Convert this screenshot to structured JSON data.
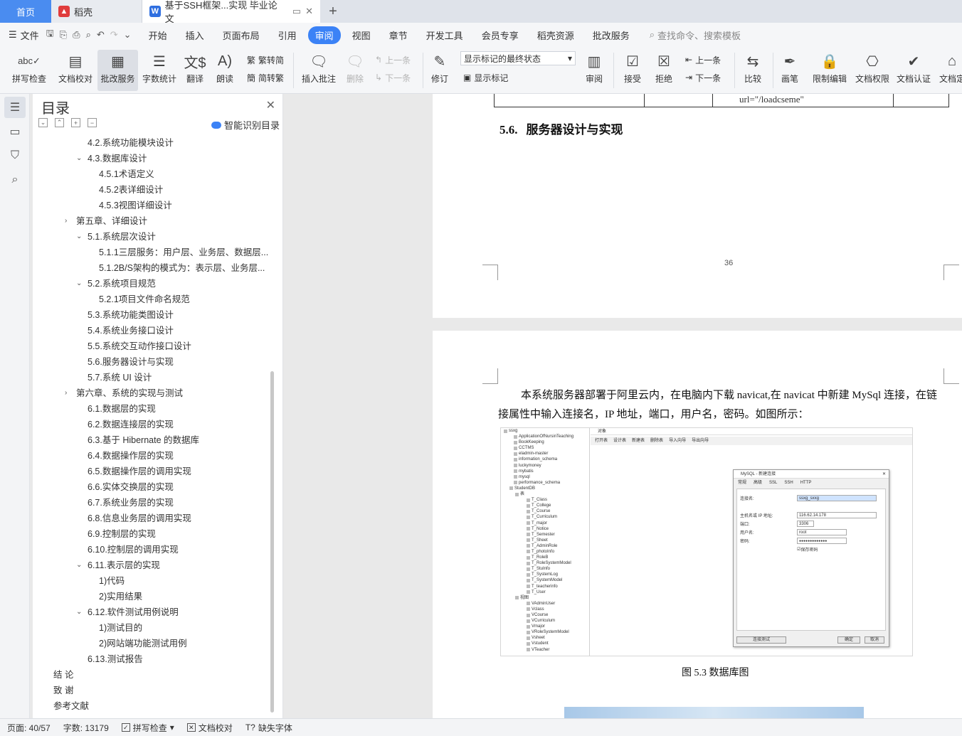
{
  "tabs": {
    "home": "首页",
    "daoke": "稻壳",
    "document": "基于SSH框架...实现 毕业论文"
  },
  "menu": {
    "file": "文件",
    "items": [
      "开始",
      "插入",
      "页面布局",
      "引用",
      "审阅",
      "视图",
      "章节",
      "开发工具",
      "会员专享",
      "稻壳资源",
      "批改服务"
    ],
    "search_placeholder": "查找命令、搜索模板"
  },
  "ribbon": {
    "spellcheck": "拼写检查",
    "doc_proof": "文档校对",
    "correction_service": "批改服务",
    "word_count": "字数统计",
    "translate": "翻译",
    "read_aloud": "朗读",
    "trad_to_simp": "繁转简",
    "simp_to_trad": "简转繁",
    "insert_comment": "插入批注",
    "delete": "删除",
    "prev": "上一条",
    "next": "下一条",
    "track_changes": "修订",
    "markup_state": "显示标记的最终状态",
    "show_markup": "显示标记",
    "review_pane": "审阅",
    "accept": "接受",
    "reject": "拒绝",
    "prev2": "上一条",
    "next2": "下一条",
    "compare": "比较",
    "pen": "画笔",
    "restrict_edit": "限制编辑",
    "doc_permission": "文档权限",
    "doc_cert": "文档认证",
    "doc_more": "文档定"
  },
  "toc": {
    "title": "目录",
    "smart": "智能识别目录",
    "items": [
      {
        "text": "4.2.系统功能模块设计",
        "level": 2,
        "arrow": ""
      },
      {
        "text": "4.3.数据库设计",
        "level": 2,
        "arrow": "v"
      },
      {
        "text": "4.5.1术语定义",
        "level": 3,
        "arrow": ""
      },
      {
        "text": "4.5.2表详细设计",
        "level": 3,
        "arrow": ""
      },
      {
        "text": "4.5.3视图详细设计",
        "level": 3,
        "arrow": ""
      },
      {
        "text": "第五章、详细设计",
        "level": 1,
        "arrow": ">"
      },
      {
        "text": "5.1.系统层次设计",
        "level": 2,
        "arrow": "v"
      },
      {
        "text": "5.1.1三层服务：用户层、业务层、数据层...",
        "level": 3,
        "arrow": ""
      },
      {
        "text": "5.1.2B/S架构的模式为：表示层、业务层...",
        "level": 3,
        "arrow": ""
      },
      {
        "text": "5.2.系统项目规范",
        "level": 2,
        "arrow": "v"
      },
      {
        "text": "5.2.1项目文件命名规范",
        "level": 3,
        "arrow": ""
      },
      {
        "text": "5.3.系统功能类图设计",
        "level": 2,
        "arrow": ""
      },
      {
        "text": "5.4.系统业务接口设计",
        "level": 2,
        "arrow": ""
      },
      {
        "text": "5.5.系统交互动作接口设计",
        "level": 2,
        "arrow": ""
      },
      {
        "text": "5.6.服务器设计与实现",
        "level": 2,
        "arrow": ""
      },
      {
        "text": "5.7.系统 UI 设计",
        "level": 2,
        "arrow": ""
      },
      {
        "text": "第六章、系统的实现与测试",
        "level": 1,
        "arrow": ">"
      },
      {
        "text": "6.1.数据层的实现",
        "level": 2,
        "arrow": ""
      },
      {
        "text": "6.2.数据连接层的实现",
        "level": 2,
        "arrow": ""
      },
      {
        "text": "6.3.基于 Hibernate 的数据库",
        "level": 2,
        "arrow": ""
      },
      {
        "text": "6.4.数据操作层的实现",
        "level": 2,
        "arrow": ""
      },
      {
        "text": "6.5.数据操作层的调用实现",
        "level": 2,
        "arrow": ""
      },
      {
        "text": "6.6.实体交换层的实现",
        "level": 2,
        "arrow": ""
      },
      {
        "text": "6.7.系统业务层的实现",
        "level": 2,
        "arrow": ""
      },
      {
        "text": "6.8.信息业务层的调用实现",
        "level": 2,
        "arrow": ""
      },
      {
        "text": "6.9.控制层的实现",
        "level": 2,
        "arrow": ""
      },
      {
        "text": "6.10.控制层的调用实现",
        "level": 2,
        "arrow": ""
      },
      {
        "text": "6.11.表示层的实现",
        "level": 2,
        "arrow": "v"
      },
      {
        "text": "1)代码",
        "level": 3,
        "arrow": ""
      },
      {
        "text": "2)实用结果",
        "level": 3,
        "arrow": ""
      },
      {
        "text": "6.12.软件测试用例说明",
        "level": 2,
        "arrow": "v"
      },
      {
        "text": "1)测试目的",
        "level": 3,
        "arrow": ""
      },
      {
        "text": "2)网站端功能测试用例",
        "level": 3,
        "arrow": ""
      },
      {
        "text": "6.13.测试报告",
        "level": 2,
        "arrow": ""
      },
      {
        "text": "结  论",
        "level": 0,
        "arrow": ""
      },
      {
        "text": "致  谢",
        "level": 0,
        "arrow": ""
      },
      {
        "text": "参考文献",
        "level": 0,
        "arrow": ""
      }
    ]
  },
  "doc": {
    "table_cell": "url=\"/loadcseme\"",
    "heading_num": "5.6.",
    "heading_text": "服务器设计与实现",
    "page_number": "36",
    "paragraph": "本系统服务器部署于阿里云内，在电脑内下载 navicat,在 navicat 中新建 MySql 连接，在链接属性中输入连接名，IP 地址，端口，用户名，密码。如图所示：",
    "caption": "图 5.3 数据库图"
  },
  "navicat": {
    "tree": [
      "ssxg",
      "ApplicationOfNursinTeaching",
      "BookKeeping",
      "CCTMS",
      "eladmin-master",
      "information_schema",
      "luckymoney",
      "mybatis",
      "mysql",
      "performance_schema",
      "StudentDB",
      "表",
      "T_Class",
      "T_College",
      "T_Course",
      "T_Curriculum",
      "T_major",
      "T_Notice",
      "T_Semester",
      "T_Sheet",
      "T_AdminRole",
      "T_photoInfo",
      "T_RoleB",
      "T_RoleSystemModel",
      "T_StuInfo",
      "T_SystemLog",
      "T_SystemModel",
      "T_teacherinfo",
      "T_User",
      "视图",
      "VAdminUser",
      "Vclass",
      "VCourse",
      "VCurriculum",
      "Vmajor",
      "VRoleSystemModel",
      "Vsheet",
      "Vstudent",
      "VTeacher"
    ],
    "object_tab": "对象",
    "toolbar": [
      "打开表",
      "设计表",
      "新建表",
      "删除表",
      "导入向导",
      "导出向导"
    ],
    "dialog_title": "MySQL - 新建连接",
    "dialog_tabs": [
      "常规",
      "高级",
      "SSL",
      "SSH",
      "HTTP"
    ],
    "conn_name_label": "连接名:",
    "conn_name": "ssxg_sxxg",
    "host_label": "主机名或 IP 地址:",
    "host": "116.62.14.178",
    "port_label": "端口:",
    "port": "3306",
    "user_label": "用户名:",
    "user": "root",
    "password_label": "密码:",
    "password": "●●●●●●●●●●●●●",
    "save_password": "保存密码",
    "test_btn": "连接测试",
    "ok_btn": "确定",
    "cancel_btn": "取消"
  },
  "status": {
    "page": "页面: 40/57",
    "words": "字数: 13179",
    "spell": "拼写检查",
    "proof": "文档校对",
    "missing_font": "缺失字体"
  }
}
